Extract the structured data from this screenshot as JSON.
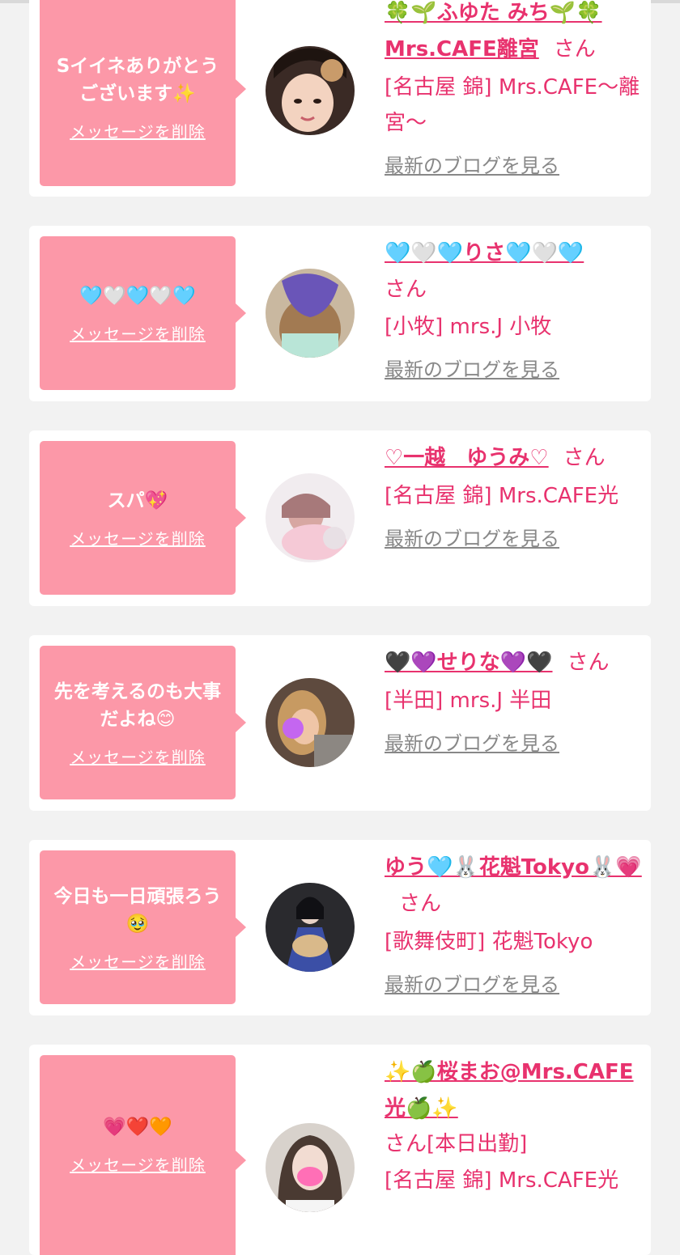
{
  "colors": {
    "accent": "#e8326e",
    "bubble": "#fc98a8",
    "link_gray": "#888888",
    "background": "#f2f2f2"
  },
  "delete_label": "メッセージを削除",
  "blog_label": "最新のブログを見る",
  "san_label": "さん",
  "cards": [
    {
      "message": "SイイネありがとうございますSPARKLE",
      "message_text": "Sイイネありがとうございます✨",
      "name": "🍀🌱ふゆた みち🌱🍀Mrs.CAFE離宮",
      "shop": "[名古屋 錦] Mrs.CAFE〜離宮〜"
    },
    {
      "message_text": "🩵🤍🩵🤍🩵",
      "name": "🩵🤍🩵りさ🩵🤍🩵",
      "shop": "[小牧] mrs.J 小牧"
    },
    {
      "message_text": "スパ💖",
      "name": "♡一越　ゆうみ♡",
      "shop": "[名古屋 錦] Mrs.CAFE光"
    },
    {
      "message_text": "先を考えるのも大事だよね😊",
      "name": "🖤💜せりな💜🖤",
      "shop": "[半田] mrs.J 半田"
    },
    {
      "message_text": "今日も一日頑張ろう🥹",
      "name": "ゆう🩵🐰花魁Tokyo🐰💗",
      "shop": "[歌舞伎町] 花魁Tokyo"
    },
    {
      "message_text": "💗❤️🧡",
      "name": "✨🍏桜まお@Mrs.CAFE光🍏✨",
      "extra": "[本日出勤]",
      "shop": "[名古屋 錦] Mrs.CAFE光"
    }
  ]
}
